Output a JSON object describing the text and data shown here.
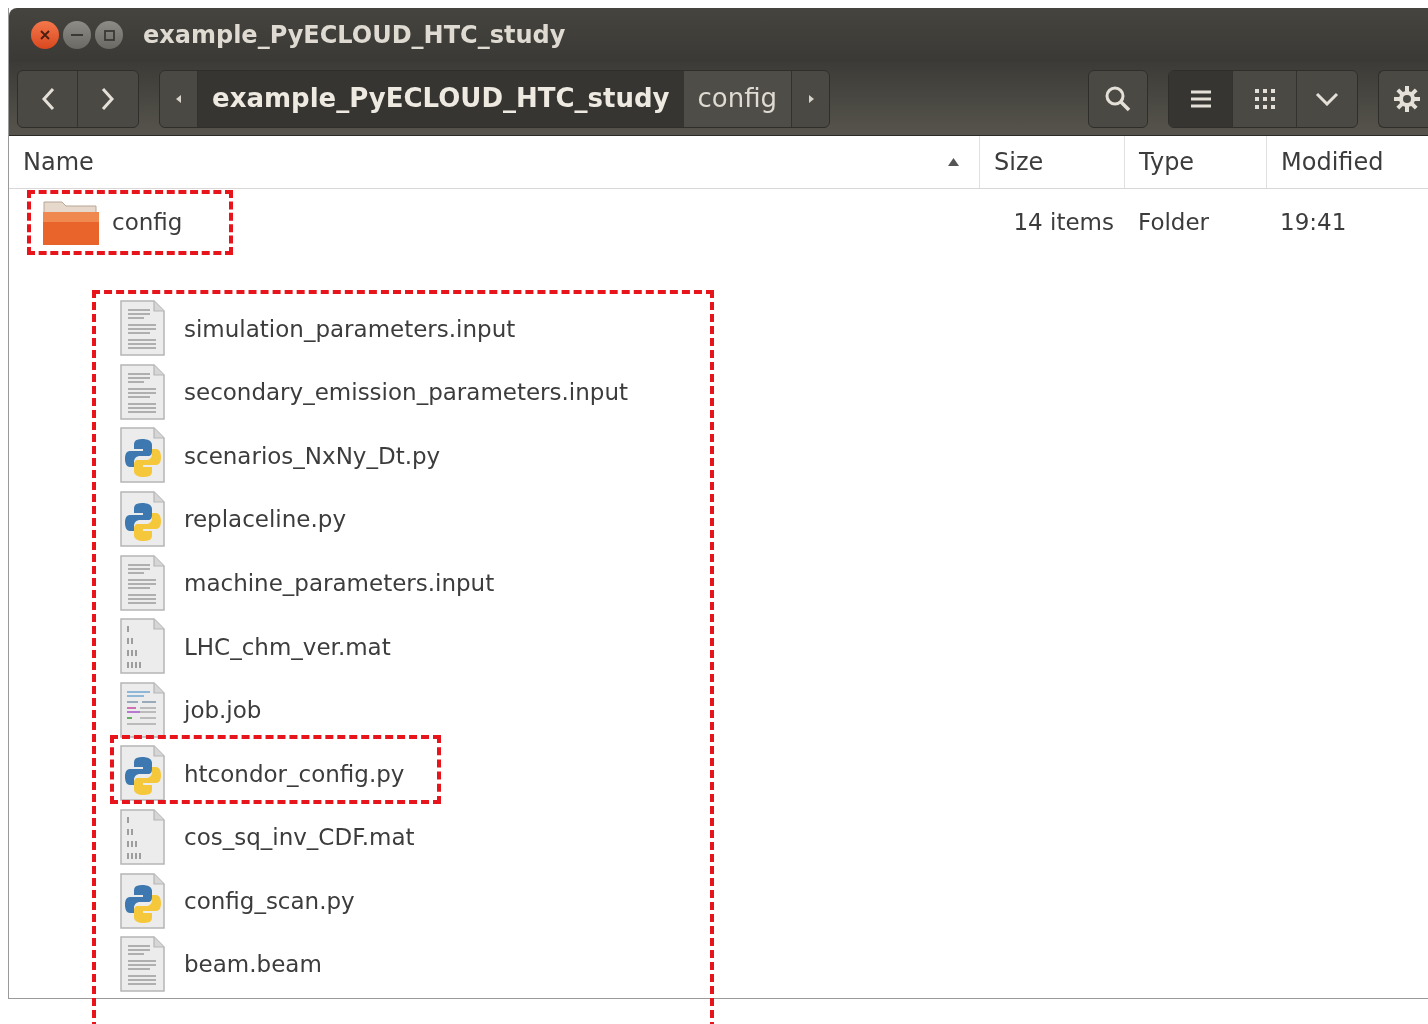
{
  "window": {
    "title": "example_PyECLOUD_HTC_study"
  },
  "path": [
    {
      "label": "example_PyECLOUD_HTC_study",
      "selected": true
    },
    {
      "label": "config",
      "selected": false
    }
  ],
  "view_modes": [
    {
      "kind": "list",
      "selected": true
    },
    {
      "kind": "grid",
      "selected": false
    }
  ],
  "columns": [
    {
      "label": "Name",
      "sorted": true
    },
    {
      "label": "Size",
      "sorted": false
    },
    {
      "label": "Type",
      "sorted": false
    },
    {
      "label": "Modified",
      "sorted": false
    }
  ],
  "rows": [
    {
      "name": "config",
      "kind": "folder",
      "size": "14 items",
      "type": "Folder",
      "modified": "19:41",
      "highlighted": true,
      "children_highlighted": true,
      "children": [
        {
          "name": "simulation_parameters.input",
          "kind": "text",
          "highlighted": false
        },
        {
          "name": "secondary_emission_parameters.input",
          "kind": "text",
          "highlighted": false
        },
        {
          "name": "scenarios_NxNy_Dt.py",
          "kind": "python",
          "highlighted": false
        },
        {
          "name": "replaceline.py",
          "kind": "python",
          "highlighted": false
        },
        {
          "name": "machine_parameters.input",
          "kind": "text",
          "highlighted": false
        },
        {
          "name": "LHC_chm_ver.mat",
          "kind": "binary",
          "highlighted": false
        },
        {
          "name": "job.job",
          "kind": "job",
          "highlighted": false
        },
        {
          "name": "htcondor_config.py",
          "kind": "python",
          "highlighted": true
        },
        {
          "name": "cos_sq_inv_CDF.mat",
          "kind": "binary",
          "highlighted": false
        },
        {
          "name": "config_scan.py",
          "kind": "python",
          "highlighted": false
        },
        {
          "name": "beam.beam",
          "kind": "text",
          "highlighted": false
        }
      ]
    }
  ]
}
